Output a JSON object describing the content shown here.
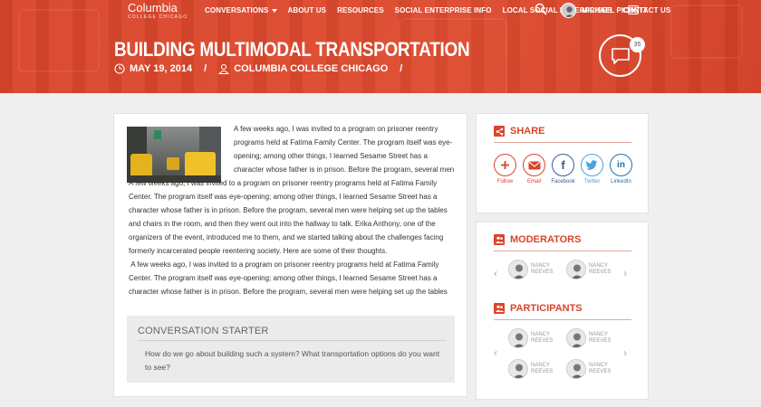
{
  "brand": {
    "name": "Columbia",
    "tagline": "COLLEGE CHICAGO"
  },
  "nav": {
    "items": [
      "CONVERSATIONS",
      "ABOUT US",
      "RESOURCES",
      "SOCIAL ENTERPRISE INFO",
      "LOCAL SOCIAL ENTERPRISES",
      "CONTACT US"
    ],
    "user": "MICHAEL PICKETT"
  },
  "post": {
    "title": "BUILDING MULTIMODAL TRANSPORTATION",
    "date": "MAY 19, 2014",
    "author": "COLUMBIA COLLEGE CHICAGO",
    "separator": "/",
    "comment_count": "35",
    "body_first": "A few weeks ago, I was invited to a program on prisoner reentry programs held at Fatima Family Center. The program itself was eye-opening; among other things, I learned Sesame Street has a character whose father is in prison. Before the program, several men",
    "body_second": "A few weeks ago, I was invited to a program on prisoner reentry programs held at Fatima Family Center. The program itself was eye-opening; among other things, I learned Sesame Street has a character whose father is in prison. Before the program, several men were helping set up the tables and chairs in the room, and then they went out into the hallway to talk. Erika Anthony, one of the organizers of the event, introduced me to them, and we started talking about the challenges facing formerly incarcerated people reentering society. Here are some of their thoughts.",
    "body_third": " A few weeks ago, I was invited to a program on prisoner reentry programs held at Fatima Family Center. The program itself was eye-opening; among other things, I learned Sesame Street has a character whose father is in prison. Before the program, several men were helping set up the tables"
  },
  "starter": {
    "heading": "CONVERSATION STARTER",
    "question": "How do we go about building such a system? What transportation options do you want to see?"
  },
  "share": {
    "heading": "SHARE",
    "items": [
      {
        "label": "Follow",
        "icon": "plus-icon",
        "color": "#d9452b"
      },
      {
        "label": "Email",
        "icon": "mail-icon",
        "color": "#d9452b"
      },
      {
        "label": "Facebook",
        "icon": "facebook-icon",
        "color": "#3b5998"
      },
      {
        "label": "Twitter",
        "icon": "twitter-icon",
        "color": "#4aa3df"
      },
      {
        "label": "LinkedIn",
        "icon": "linkedin-icon",
        "color": "#1f6fa8"
      }
    ]
  },
  "moderators": {
    "heading": "MODERATORS",
    "people": [
      {
        "first": "NANCY",
        "last": "REEVES"
      },
      {
        "first": "NANCY",
        "last": "REEVES"
      }
    ]
  },
  "participants": {
    "heading": "PARTICIPANTS",
    "people": [
      {
        "first": "NANCY",
        "last": "REEVES"
      },
      {
        "first": "NANCY",
        "last": "REEVES"
      },
      {
        "first": "NANCY",
        "last": "REEVES"
      },
      {
        "first": "NANCY",
        "last": "REEVES"
      }
    ]
  },
  "colors": {
    "accent": "#d9452b",
    "facebook": "#3b5998",
    "twitter": "#4aa3df",
    "linkedin": "#1f6fa8"
  }
}
